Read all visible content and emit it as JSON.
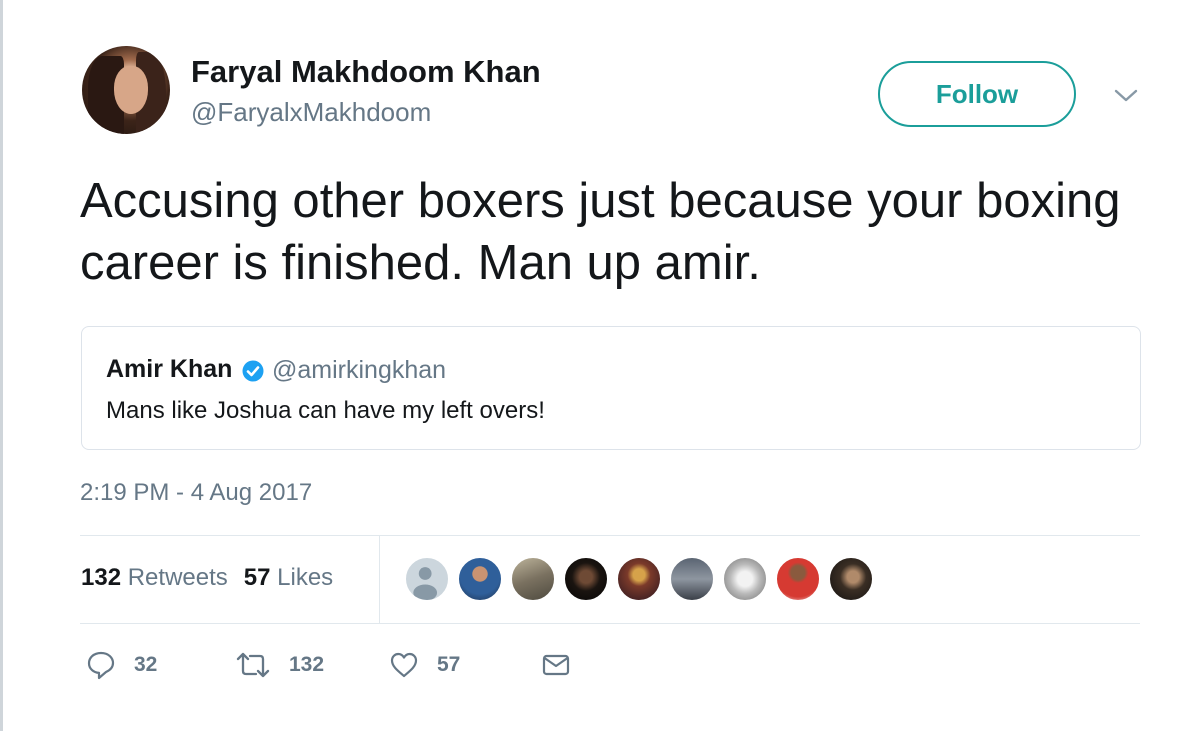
{
  "author": {
    "name": "Faryal Makhdoom Khan",
    "handle": "@FaryalxMakhdoom"
  },
  "follow_label": "Follow",
  "tweet_text": "Accusing other boxers just because your boxing career is finished. Man up amir.",
  "quoted": {
    "name": "Amir Khan",
    "handle": "@amirkingkhan",
    "text": "Mans like Joshua can have my left overs!"
  },
  "timestamp": "2:19 PM - 4 Aug 2017",
  "stats": {
    "retweets_count": "132",
    "retweets_label": "Retweets",
    "likes_count": "57",
    "likes_label": "Likes"
  },
  "actions": {
    "reply_count": "32",
    "retweet_count": "132",
    "like_count": "57"
  },
  "colors": {
    "accent": "#1b9e9a",
    "verified": "#1da1f2",
    "muted": "#657786"
  }
}
